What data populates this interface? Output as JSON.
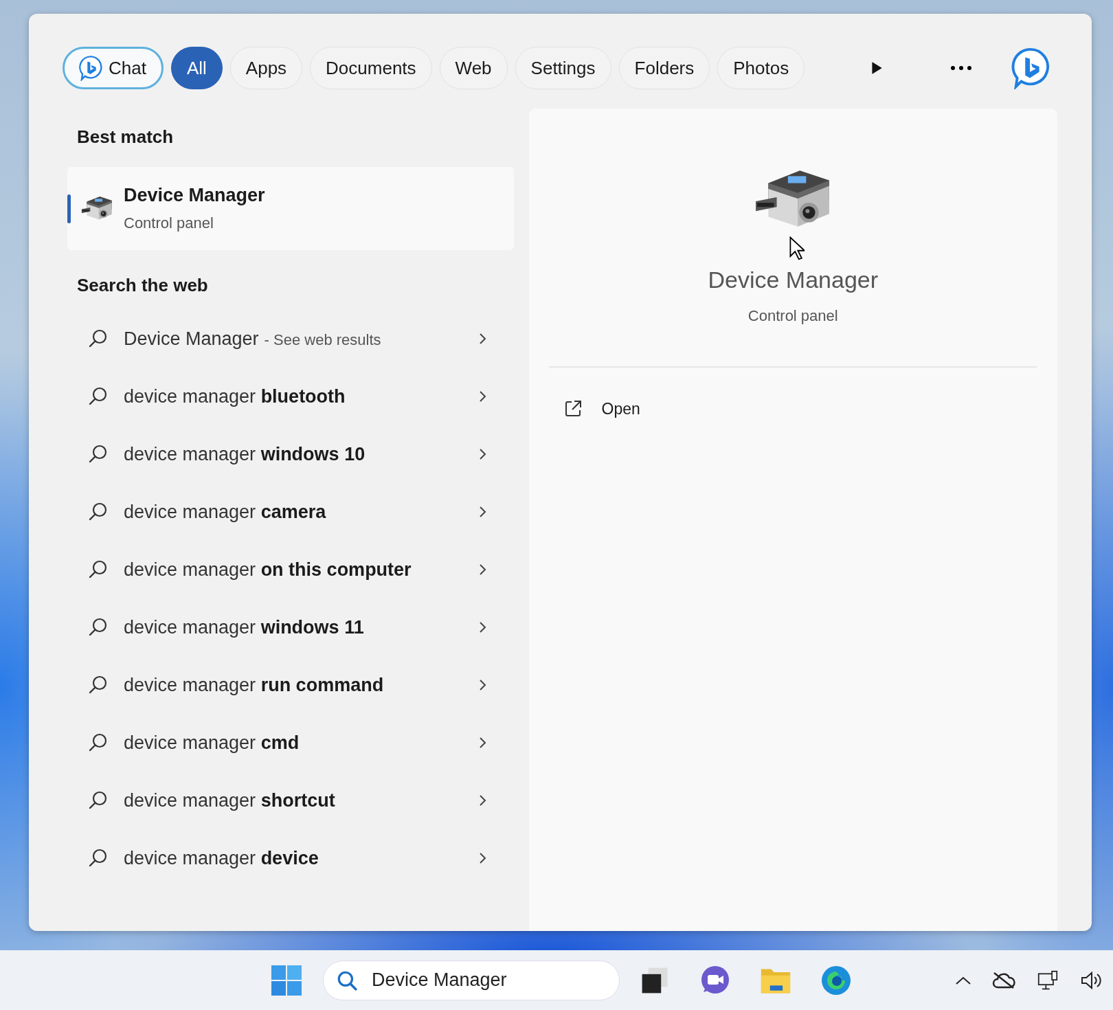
{
  "filters": [
    {
      "label": "Chat",
      "kind": "chat",
      "selected": false
    },
    {
      "label": "All",
      "kind": "text",
      "selected": true
    },
    {
      "label": "Apps",
      "kind": "text",
      "selected": false
    },
    {
      "label": "Documents",
      "kind": "text",
      "selected": false
    },
    {
      "label": "Web",
      "kind": "text",
      "selected": false
    },
    {
      "label": "Settings",
      "kind": "text",
      "selected": false
    },
    {
      "label": "Folders",
      "kind": "text",
      "selected": false
    },
    {
      "label": "Photos",
      "kind": "text",
      "selected": false
    }
  ],
  "best_match": {
    "heading": "Best match",
    "title": "Device Manager",
    "subtitle": "Control panel",
    "selected": true
  },
  "web": {
    "heading": "Search the web",
    "items": [
      {
        "text": "Device Manager",
        "suffix": "- See web results"
      },
      {
        "text": "device manager **bluetooth**"
      },
      {
        "text": "device manager **windows 10**"
      },
      {
        "text": "device manager **camera**"
      },
      {
        "text": "device manager **on this computer**"
      },
      {
        "text": "device manager **windows 11**"
      },
      {
        "text": "device manager **run command**"
      },
      {
        "text": "device manager **cmd**"
      },
      {
        "text": "device manager **shortcut**"
      },
      {
        "text": "device manager **device**"
      }
    ]
  },
  "preview": {
    "title": "Device Manager",
    "subtitle": "Control panel",
    "actions": [
      {
        "label": "Open"
      }
    ]
  },
  "taskbar": {
    "search": {
      "value": "Device Manager"
    }
  }
}
